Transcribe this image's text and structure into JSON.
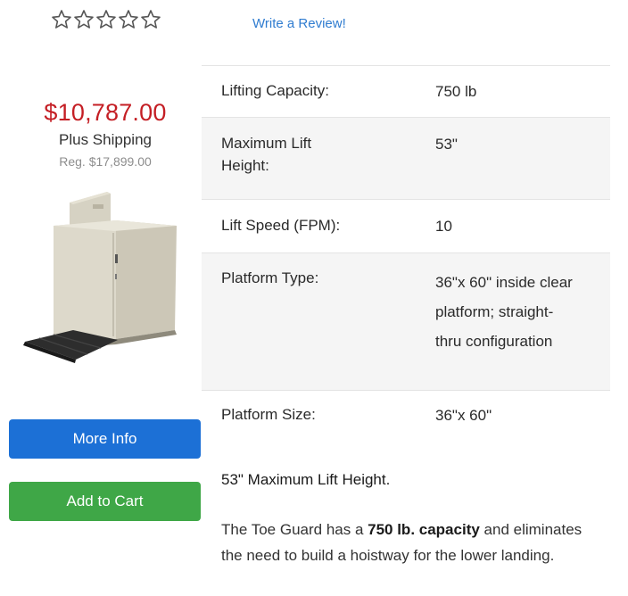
{
  "rating": {
    "stars_filled": 0,
    "stars_total": 5
  },
  "review_link": "Write a Review!",
  "pricing": {
    "price": "$10,787.00",
    "shipping": "Plus Shipping",
    "regular": "Reg. $17,899.00"
  },
  "buttons": {
    "more_info": "More Info",
    "add_to_cart": "Add to Cart"
  },
  "specs": [
    {
      "label": "Lifting Capacity:",
      "value": "750 lb"
    },
    {
      "label": "Maximum Lift Height:",
      "value": "53\""
    },
    {
      "label": "Lift Speed (FPM):",
      "value": "10"
    },
    {
      "label": "Platform Type:",
      "value": "36\"x 60\" inside clear platform; straight- thru configuration"
    },
    {
      "label": "Platform Size:",
      "value": "36\"x 60\""
    }
  ],
  "headline": "53\" Maximum Lift Height.",
  "description": {
    "part1": "The Toe Guard has a ",
    "bold": "750 lb. capacity",
    "part2": " and eliminates the need to build a hoistway for the lower landing."
  },
  "colors": {
    "price": "#c41e24",
    "link": "#2f7cd0",
    "more_info_button": "#1c70d6",
    "add_to_cart_button": "#3fa747"
  }
}
